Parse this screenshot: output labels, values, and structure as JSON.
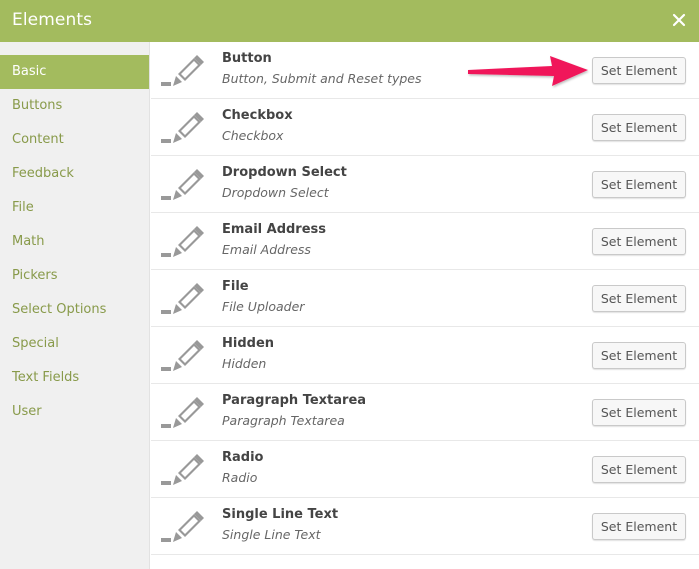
{
  "header": {
    "title": "Elements",
    "close_icon": "close-icon"
  },
  "sidebar": {
    "items": [
      {
        "label": "Basic",
        "active": true
      },
      {
        "label": "Buttons",
        "active": false
      },
      {
        "label": "Content",
        "active": false
      },
      {
        "label": "Feedback",
        "active": false
      },
      {
        "label": "File",
        "active": false
      },
      {
        "label": "Math",
        "active": false
      },
      {
        "label": "Pickers",
        "active": false
      },
      {
        "label": "Select Options",
        "active": false
      },
      {
        "label": "Special",
        "active": false
      },
      {
        "label": "Text Fields",
        "active": false
      },
      {
        "label": "User",
        "active": false
      }
    ]
  },
  "elements": {
    "icon": "pencil-icon",
    "button_label": "Set Element",
    "items": [
      {
        "name": "Button",
        "description": "Button, Submit and Reset types"
      },
      {
        "name": "Checkbox",
        "description": "Checkbox"
      },
      {
        "name": "Dropdown Select",
        "description": "Dropdown Select"
      },
      {
        "name": "Email Address",
        "description": "Email Address"
      },
      {
        "name": "File",
        "description": "File Uploader"
      },
      {
        "name": "Hidden",
        "description": "Hidden"
      },
      {
        "name": "Paragraph Textarea",
        "description": "Paragraph Textarea"
      },
      {
        "name": "Radio",
        "description": "Radio"
      },
      {
        "name": "Single Line Text",
        "description": "Single Line Text"
      }
    ]
  },
  "annotation": {
    "type": "arrow",
    "color": "#f0185a",
    "points_to": "Button Set Element"
  },
  "colors": {
    "accent": "#a3bb5e",
    "sidebar_text": "#889a4a"
  }
}
